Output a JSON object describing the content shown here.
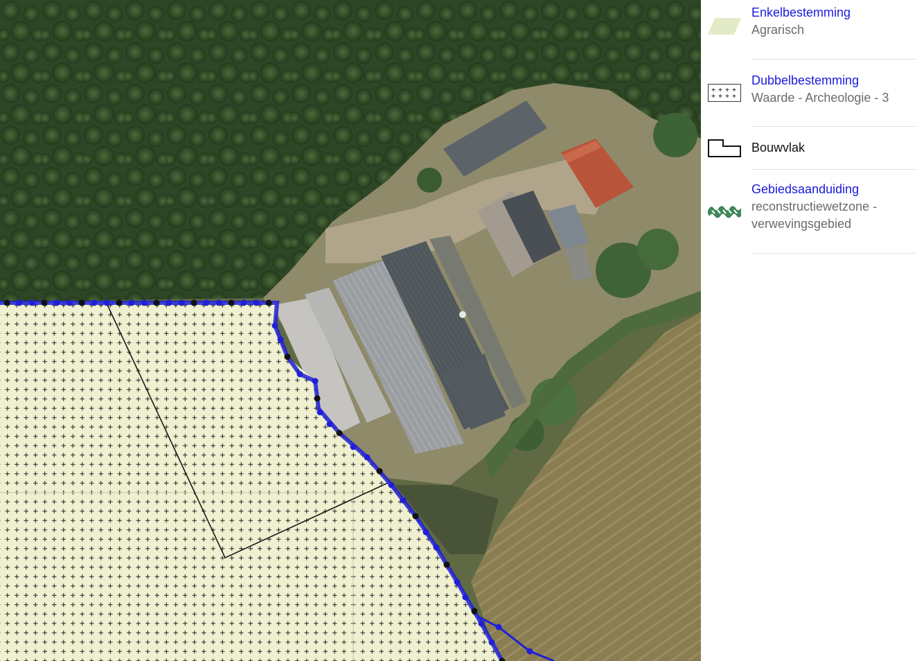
{
  "map": {
    "layers": [
      {
        "name": "aerial-photo",
        "type": "background"
      },
      {
        "name": "agrarisch-area",
        "fill": "#eef0d0",
        "pattern": "plus-grid"
      },
      {
        "name": "bouwvlak-outline",
        "stroke": "#1a1a1a"
      },
      {
        "name": "plan-boundary",
        "stroke": "#1f1fd6"
      }
    ],
    "colors": {
      "forest": "#2f4a26",
      "field": "#8a7d52",
      "roof_gray": "#8b8f92",
      "roof_dark": "#4d5459",
      "roof_red": "#b8553a",
      "yard": "#a89a80",
      "boundary_blue": "#1f1fd6"
    }
  },
  "legend": {
    "items": [
      {
        "key": "enkelbestemming",
        "title": "Enkelbestemming",
        "subtitle": "Agrarisch",
        "swatch": "light-green-parallelogram",
        "swatch_color": "#e3ebc6"
      },
      {
        "key": "dubbelbestemming",
        "title": "Dubbelbestemming",
        "subtitle": "Waarde - Archeologie - 3",
        "swatch": "plus-grid-box"
      },
      {
        "key": "bouwvlak",
        "title": "Bouwvlak",
        "subtitle": "",
        "swatch": "bouwvlak-outline"
      },
      {
        "key": "gebiedsaanduiding",
        "title": "Gebiedsaanduiding",
        "subtitle": "reconstructiewetzone -",
        "subtitle2": "verwevingsgebied",
        "swatch": "green-wave-pattern",
        "swatch_color": "#3d8a5a"
      }
    ]
  }
}
